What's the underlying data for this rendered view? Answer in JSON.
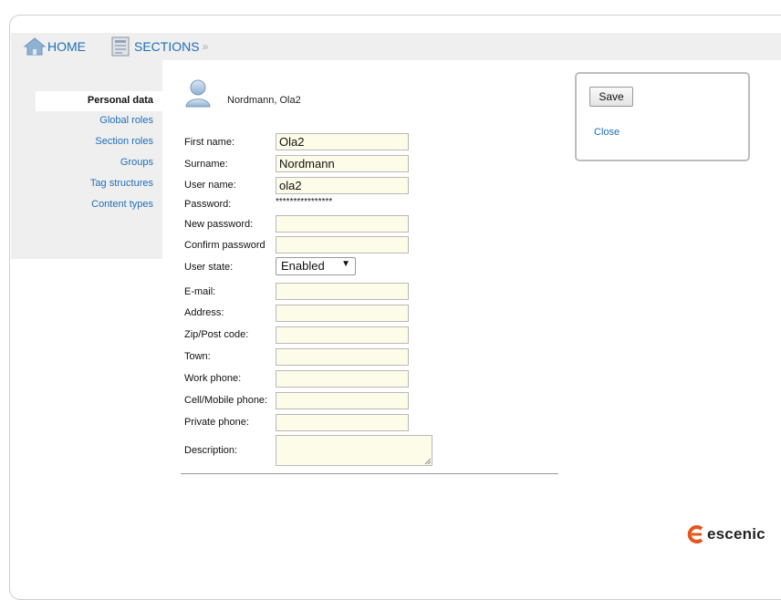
{
  "breadcrumb": {
    "home_label": "HOME",
    "sections_label": "SECTIONS",
    "separator": "»"
  },
  "sidebar": {
    "items": [
      {
        "label": "Personal data",
        "active": true
      },
      {
        "label": "Global roles"
      },
      {
        "label": "Section roles"
      },
      {
        "label": "Groups"
      },
      {
        "label": "Tag structures"
      },
      {
        "label": "Content types"
      }
    ]
  },
  "user": {
    "display_name": "Nordmann, Ola2"
  },
  "form": {
    "first_name_label": "First name:",
    "first_name_value": "Ola2",
    "surname_label": "Surname:",
    "surname_value": "Nordmann",
    "username_label": "User name:",
    "username_value": "ola2",
    "password_label": "Password:",
    "password_value": "****************",
    "new_password_label": "New password:",
    "confirm_password_label": "Confirm password",
    "user_state_label": "User state:",
    "user_state_value": "Enabled",
    "email_label": "E-mail:",
    "address_label": "Address:",
    "zip_label": "Zip/Post code:",
    "town_label": "Town:",
    "work_phone_label": "Work phone:",
    "cell_phone_label": "Cell/Mobile phone:",
    "private_phone_label": "Private phone:",
    "description_label": "Description:"
  },
  "actions": {
    "save_label": "Save",
    "close_label": "Close"
  },
  "brand": {
    "name": "escenic",
    "color": "#e8541e"
  }
}
